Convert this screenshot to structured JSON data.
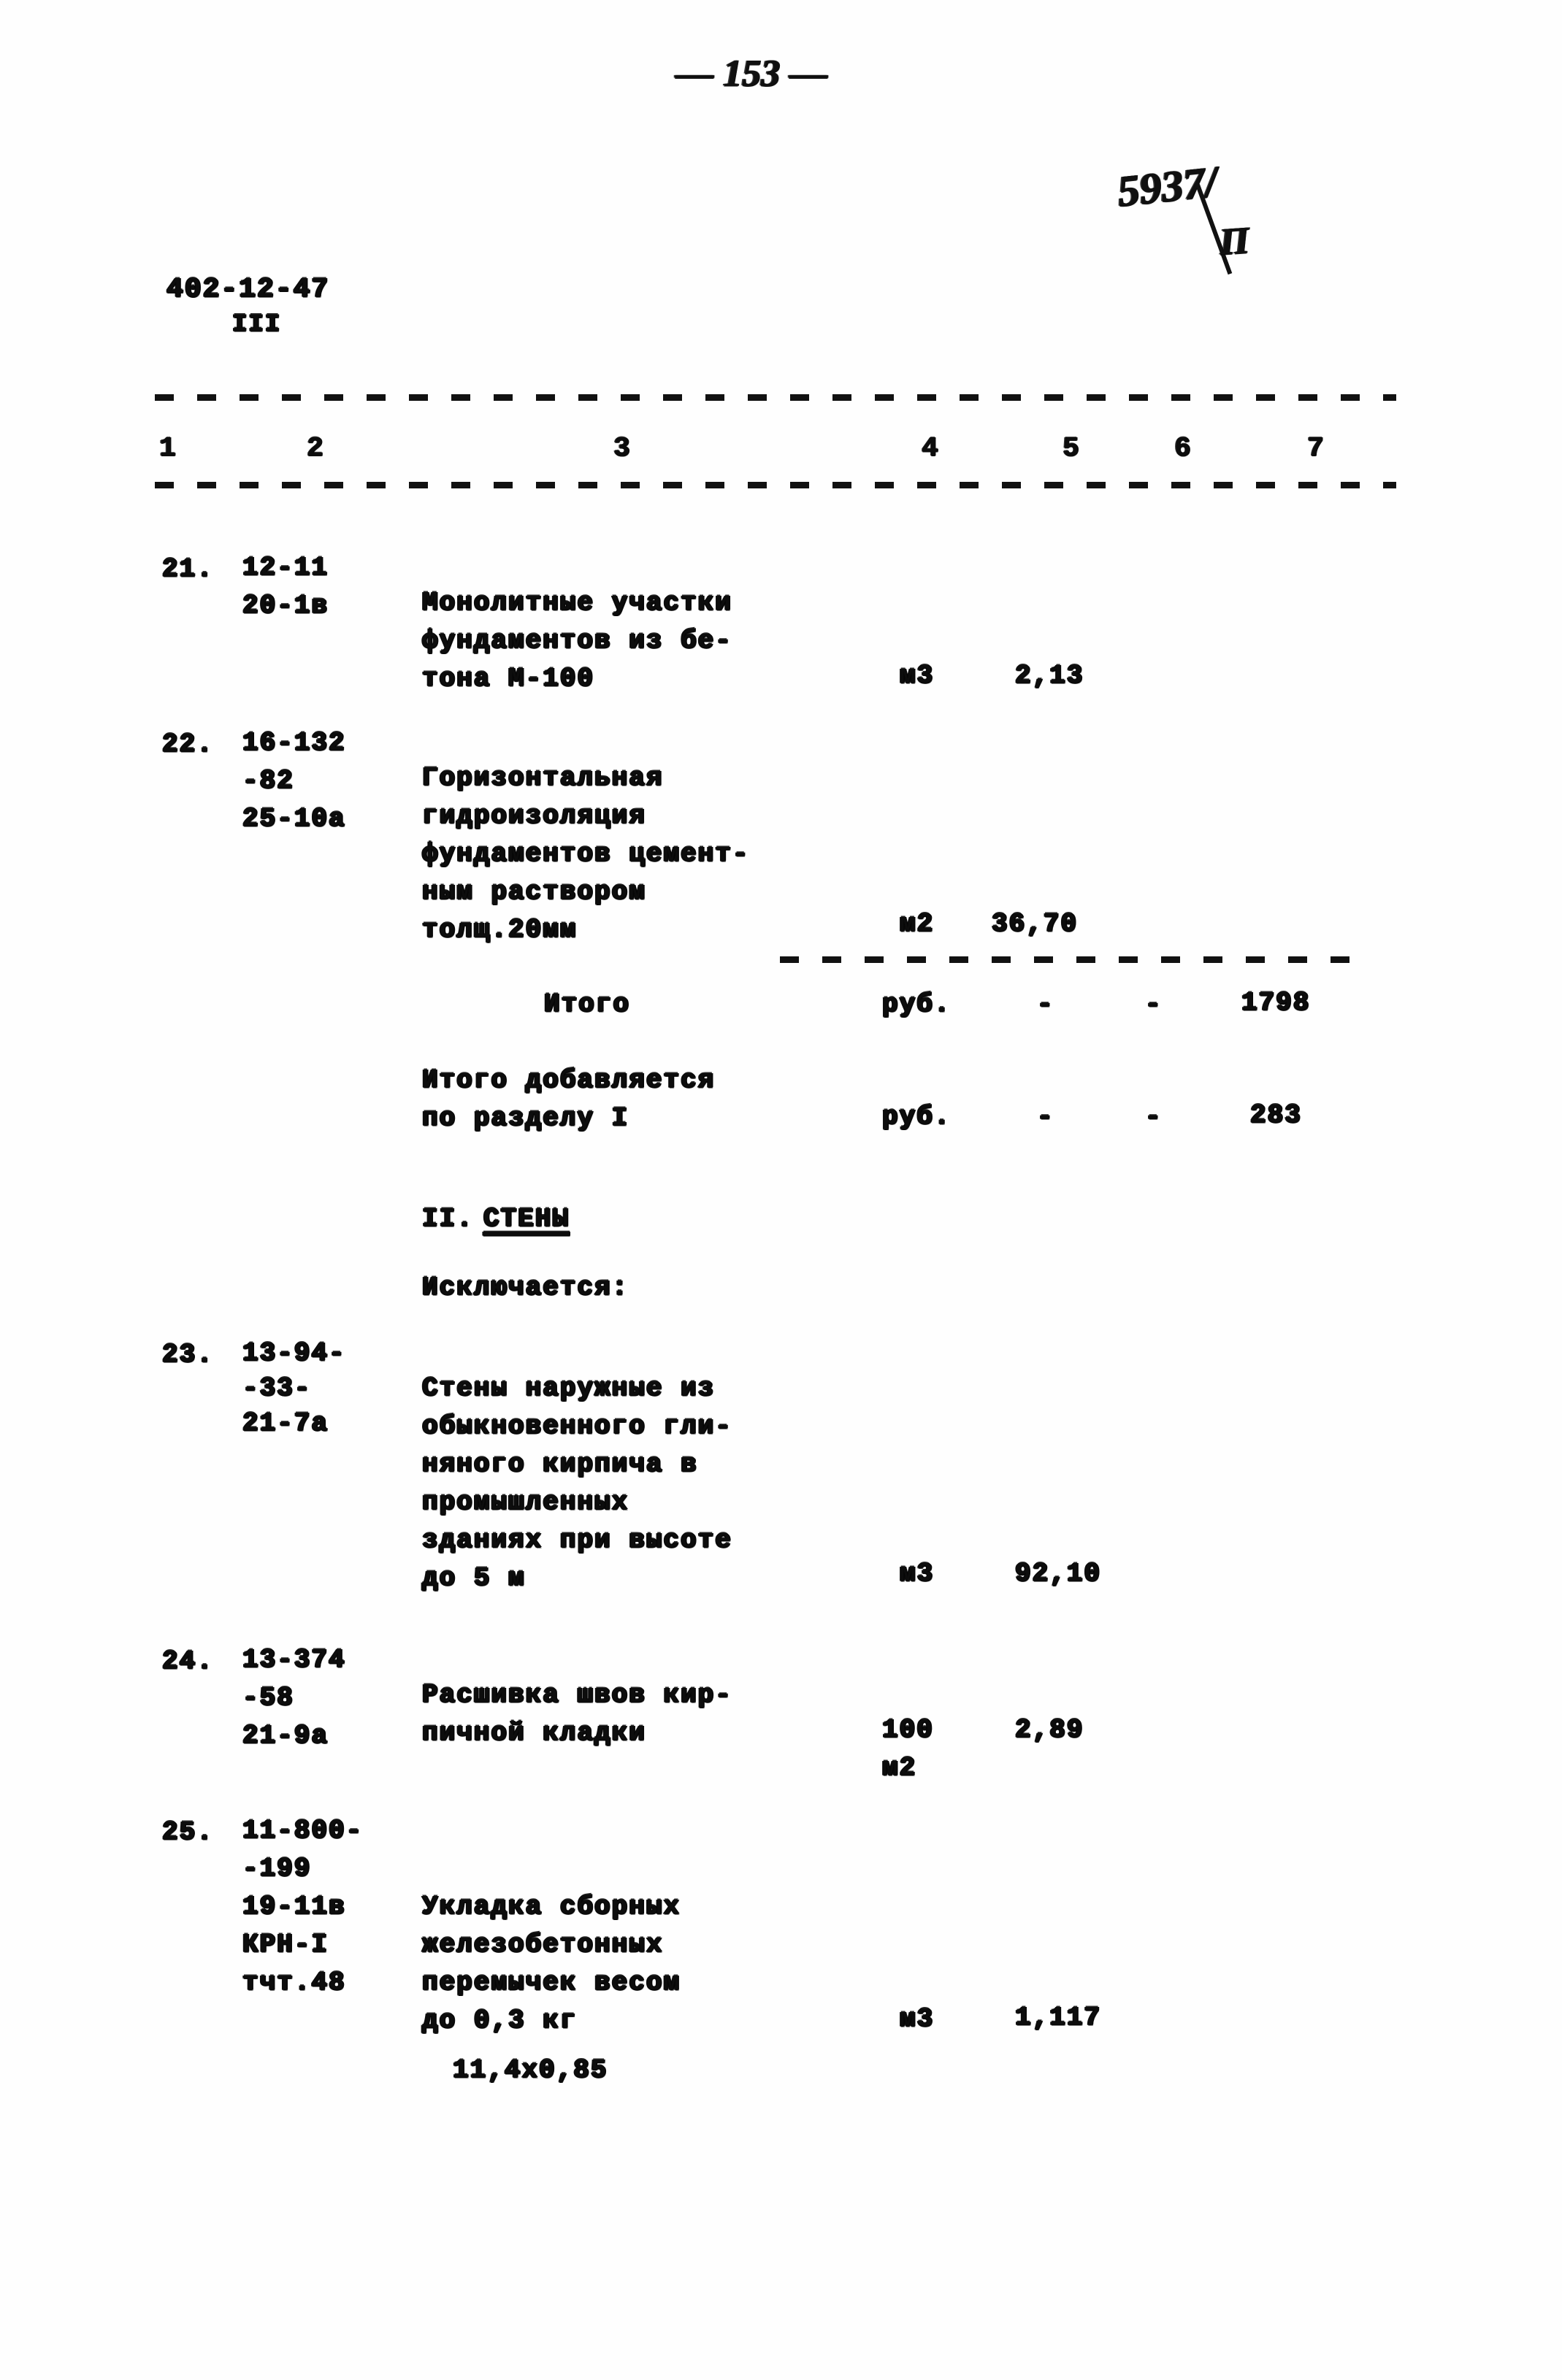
{
  "document": {
    "page_marker": "— 153 —",
    "stamp_number": "5937/",
    "stamp_denominator": "П",
    "sheet_code": "402-12-47",
    "sheet_code_sub": "III"
  },
  "table": {
    "column_headers": [
      "1",
      "2",
      "3",
      "4",
      "5",
      "6",
      "7"
    ],
    "rows": [
      {
        "no": "21.",
        "codes": [
          "12-11",
          "20-1в"
        ],
        "description": [
          "Монолитные участки",
          "фундаментов из бе-",
          "тона М-100"
        ],
        "unit": "м3",
        "qty": "2,13",
        "col5": "",
        "col6": "",
        "col7": ""
      },
      {
        "no": "22.",
        "codes": [
          "16-132",
          "-82",
          "25-10а"
        ],
        "description": [
          "Горизонтальная",
          "гидроизоляция",
          "фундаментов цемент-",
          "ным раствором",
          "толщ.20мм"
        ],
        "unit": "м2",
        "qty": "36,70",
        "col5": "",
        "col6": "",
        "col7": ""
      }
    ],
    "totals": [
      {
        "label": [
          "Итого"
        ],
        "unit": "руб.",
        "col5": "-",
        "col6": "-",
        "col7": "1798"
      },
      {
        "label": [
          "Итого добавляется",
          "по разделу I"
        ],
        "unit": "руб.",
        "col5": "-",
        "col6": "-",
        "col7": "283"
      }
    ],
    "section": {
      "number": "II.",
      "title": "СТЕНЫ",
      "note": "Исключается:"
    },
    "rows2": [
      {
        "no": "23.",
        "codes": [
          "13-94-",
          "-33-",
          "21-7а"
        ],
        "description": [
          "Стены наружные из",
          "обыкновенного гли-",
          "няного кирпича в",
          "промышленных",
          "зданиях при высоте",
          "до 5 м"
        ],
        "unit": "м3",
        "qty": "92,10",
        "col5": "",
        "col6": "",
        "col7": ""
      },
      {
        "no": "24.",
        "codes": [
          "13-374",
          "-58",
          "21-9а"
        ],
        "description": [
          "Расшивка швов кир-",
          "пичной кладки"
        ],
        "unit": "100",
        "unit2": "м2",
        "qty": "2,89",
        "col5": "",
        "col6": "",
        "col7": ""
      },
      {
        "no": "25.",
        "codes": [
          "11-800-",
          "-199",
          "19-11в",
          "КРН-I",
          "тчт.48"
        ],
        "description": [
          "Укладка сборных",
          "железобетонных",
          "перемычек весом",
          "до 0,3 кг"
        ],
        "unit": "м3",
        "qty": "1,117",
        "col5": "",
        "col6": "",
        "col7": "",
        "extra_note": "11,4х0,85"
      }
    ]
  }
}
